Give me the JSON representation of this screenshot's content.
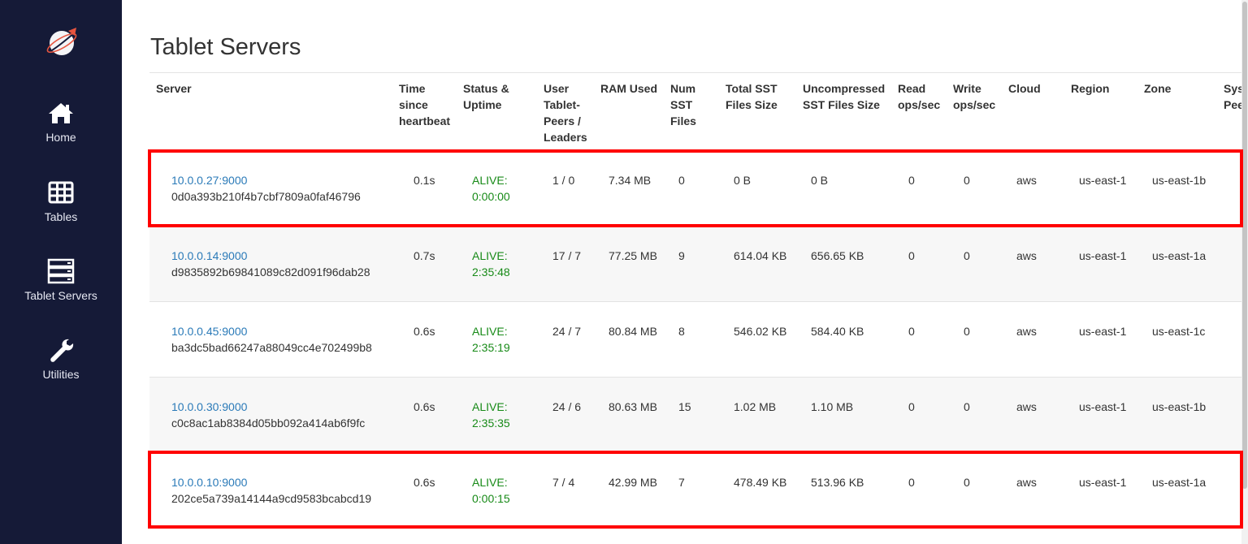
{
  "nav": {
    "items": [
      {
        "label": "Home",
        "icon": "home-icon"
      },
      {
        "label": "Tables",
        "icon": "table-icon"
      },
      {
        "label": "Tablet Servers",
        "icon": "server-stack-icon"
      },
      {
        "label": "Utilities",
        "icon": "wrench-icon"
      }
    ]
  },
  "page": {
    "title": "Tablet Servers"
  },
  "table": {
    "headers": {
      "server": "Server",
      "time_since_heartbeat": "Time since heartbeat",
      "status_uptime": "Status & Uptime",
      "user_tablet_peers_leaders": "User Tablet-Peers / Leaders",
      "ram_used": "RAM Used",
      "num_sst_files": "Num SST Files",
      "total_sst_files_size": "Total SST Files Size",
      "uncompressed_sst_files_size": "Uncompressed SST Files Size",
      "read_ops": "Read ops/sec",
      "write_ops": "Write ops/sec",
      "cloud": "Cloud",
      "region": "Region",
      "zone": "Zone",
      "system_tablet_peers_leaders": "System Tablet-Peers / Leaders"
    },
    "rows": [
      {
        "address": "10.0.0.27:9000",
        "uuid": "0d0a393b210f4b7cbf7809a0faf46796",
        "heartbeat": "0.1s",
        "status": "ALIVE:",
        "uptime": "0:00:00",
        "peers_leaders": "1 / 0",
        "ram": "7.34 MB",
        "num_sst": "0",
        "total_sst": "0 B",
        "uncompressed_sst": "0 B",
        "read_ops": "0",
        "write_ops": "0",
        "cloud": "aws",
        "region": "us-east-1",
        "zone": "us-east-1b"
      },
      {
        "address": "10.0.0.14:9000",
        "uuid": "d9835892b69841089c82d091f96dab28",
        "heartbeat": "0.7s",
        "status": "ALIVE:",
        "uptime": "2:35:48",
        "peers_leaders": "17 / 7",
        "ram": "77.25 MB",
        "num_sst": "9",
        "total_sst": "614.04 KB",
        "uncompressed_sst": "656.65 KB",
        "read_ops": "0",
        "write_ops": "0",
        "cloud": "aws",
        "region": "us-east-1",
        "zone": "us-east-1a"
      },
      {
        "address": "10.0.0.45:9000",
        "uuid": "ba3dc5bad66247a88049cc4e702499b8",
        "heartbeat": "0.6s",
        "status": "ALIVE:",
        "uptime": "2:35:19",
        "peers_leaders": "24 / 7",
        "ram": "80.84 MB",
        "num_sst": "8",
        "total_sst": "546.02 KB",
        "uncompressed_sst": "584.40 KB",
        "read_ops": "0",
        "write_ops": "0",
        "cloud": "aws",
        "region": "us-east-1",
        "zone": "us-east-1c"
      },
      {
        "address": "10.0.0.30:9000",
        "uuid": "c0c8ac1ab8384d05bb092a414ab6f9fc",
        "heartbeat": "0.6s",
        "status": "ALIVE:",
        "uptime": "2:35:35",
        "peers_leaders": "24 / 6",
        "ram": "80.63 MB",
        "num_sst": "15",
        "total_sst": "1.02 MB",
        "uncompressed_sst": "1.10 MB",
        "read_ops": "0",
        "write_ops": "0",
        "cloud": "aws",
        "region": "us-east-1",
        "zone": "us-east-1b"
      },
      {
        "address": "10.0.0.10:9000",
        "uuid": "202ce5a739a14144a9cd9583bcabcd19",
        "heartbeat": "0.6s",
        "status": "ALIVE:",
        "uptime": "0:00:15",
        "peers_leaders": "7 / 4",
        "ram": "42.99 MB",
        "num_sst": "7",
        "total_sst": "478.49 KB",
        "uncompressed_sst": "513.96 KB",
        "read_ops": "0",
        "write_ops": "0",
        "cloud": "aws",
        "region": "us-east-1",
        "zone": "us-east-1a"
      }
    ]
  },
  "colors": {
    "sidebar_bg": "#151a37",
    "link": "#2a7ab8",
    "alive": "#178a17",
    "highlight": "#ff0000"
  }
}
